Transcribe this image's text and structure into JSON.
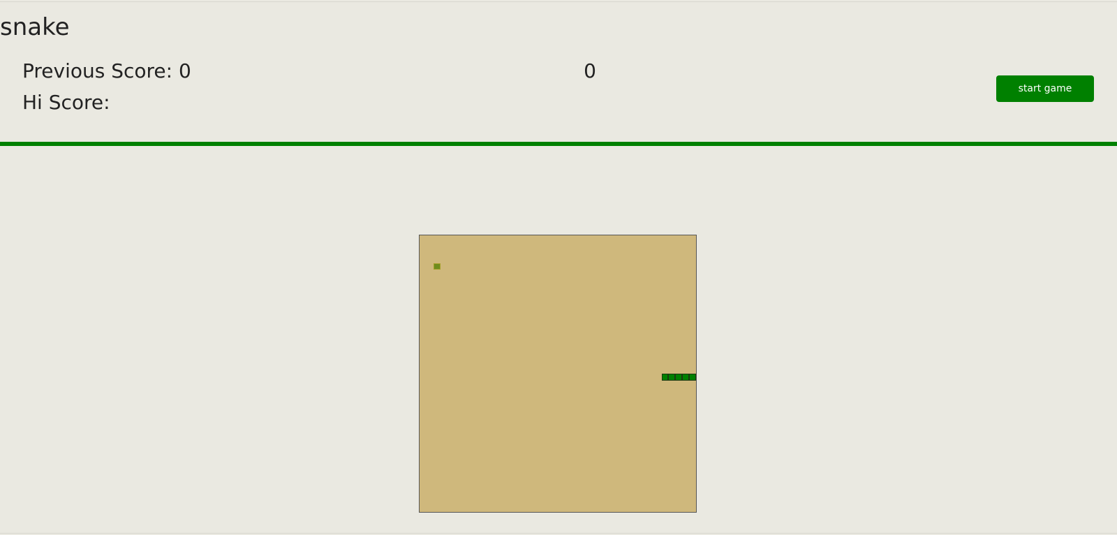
{
  "app": {
    "title": "snake"
  },
  "scores": {
    "previous_label": "Previous Score: 0",
    "hi_label": "Hi Score:",
    "current": "0"
  },
  "controls": {
    "start_label": "start game"
  },
  "game": {
    "grid_cols": 40,
    "grid_rows": 40,
    "food": {
      "col": 2,
      "row": 4
    },
    "snake": [
      {
        "col": 35,
        "row": 20
      },
      {
        "col": 36,
        "row": 20
      },
      {
        "col": 37,
        "row": 20
      },
      {
        "col": 38,
        "row": 20
      },
      {
        "col": 39,
        "row": 20
      }
    ]
  },
  "colors": {
    "accent": "#008000",
    "board": "#cfb87c",
    "background": "#eae9e1",
    "food": "#6f8c1e"
  }
}
